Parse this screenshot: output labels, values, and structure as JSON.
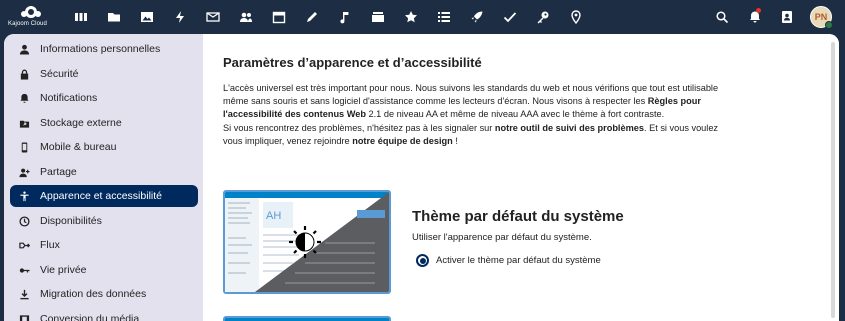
{
  "brand": {
    "name": "Kajoom Cloud"
  },
  "topbar": {
    "apps": [
      {
        "icon": "dashboard-icon"
      },
      {
        "icon": "files-icon"
      },
      {
        "icon": "photos-icon"
      },
      {
        "icon": "activity-icon"
      },
      {
        "icon": "mail-icon"
      },
      {
        "icon": "contacts-icon"
      },
      {
        "icon": "calendar-icon"
      },
      {
        "icon": "notes-icon"
      },
      {
        "icon": "music-icon"
      },
      {
        "icon": "deck-icon"
      },
      {
        "icon": "favorites-icon"
      },
      {
        "icon": "tasks-icon"
      },
      {
        "icon": "announcements-icon"
      },
      {
        "icon": "check-icon"
      },
      {
        "icon": "passwords-icon"
      },
      {
        "icon": "maps-icon"
      }
    ],
    "avatar_initials": "PN"
  },
  "sidebar": {
    "items": [
      {
        "label": "Informations personnelles",
        "icon": "user-icon"
      },
      {
        "label": "Sécurité",
        "icon": "lock-icon"
      },
      {
        "label": "Notifications",
        "icon": "bell-icon"
      },
      {
        "label": "Stockage externe",
        "icon": "external-storage-icon"
      },
      {
        "label": "Mobile & bureau",
        "icon": "phone-icon"
      },
      {
        "label": "Partage",
        "icon": "share-icon"
      },
      {
        "label": "Apparence et accessibilité",
        "icon": "accessibility-icon",
        "active": true
      },
      {
        "label": "Disponibilités",
        "icon": "clock-icon"
      },
      {
        "label": "Flux",
        "icon": "flow-icon"
      },
      {
        "label": "Vie privée",
        "icon": "key-icon"
      },
      {
        "label": "Migration des données",
        "icon": "download-icon"
      },
      {
        "label": "Conversion du média",
        "icon": "film-icon"
      }
    ]
  },
  "main": {
    "title": "Paramètres d’apparence et d’accessibilité",
    "para1_a": "L'accès universel est très important pour nous. Nous suivons les standards du web et nous vérifions que tout est utilisable même sans souris et sans logiciel d'assistance comme les lecteurs d'écran. Nous visons à respecter les ",
    "para1_bold": "Règles pour l'accessibilité des contenus Web",
    "para1_b": " 2.1 de niveau AA et même de niveau AAA avec le thème à fort contraste.",
    "para2_a": "Si vous rencontrez des problèmes, n'hésitez pas à les signaler sur ",
    "para2_bold1": "notre outil de suivi des problèmes",
    "para2_b": ". Et si vous voulez vous impliquer, venez rejoindre ",
    "para2_bold2": "notre équipe de design",
    "para2_c": " !",
    "theme": {
      "title": "Thème par défaut du système",
      "subtitle": "Utiliser l'apparence par défaut du système.",
      "radio_label": "Activer le thème par défaut du système",
      "preview_initials": "AH"
    }
  },
  "colors": {
    "header_bg": "#1d2d44",
    "sidebar_bg": "#e4e1ee",
    "active_item": "#00295e",
    "accent": "#0082c9"
  }
}
